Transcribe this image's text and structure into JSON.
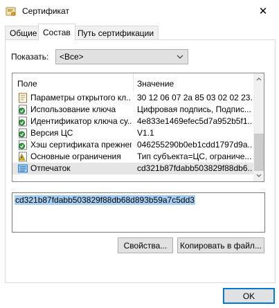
{
  "window": {
    "title": "Сертификат",
    "close_symbol": "✕"
  },
  "tabs": [
    {
      "label": "Общие"
    },
    {
      "label": "Состав",
      "active": true
    },
    {
      "label": "Путь сертификации"
    }
  ],
  "filter": {
    "label": "Показать:",
    "value": "<Все>"
  },
  "table": {
    "headers": {
      "field": "Поле",
      "value": "Значение"
    },
    "rows": [
      {
        "icon": "certificate-field-icon",
        "field": "Параметры открытого кл...",
        "value": "30 12 06 07 2a 85 03 02 02 23..."
      },
      {
        "icon": "extension-icon",
        "field": "Использование ключа",
        "value": "Цифровая подпись, Подпис..."
      },
      {
        "icon": "extension-icon",
        "field": "Идентификатор ключа су...",
        "value": "4e833e1469efec5d7a952b5f1..."
      },
      {
        "icon": "extension-icon",
        "field": "Версия ЦС",
        "value": "V1.1"
      },
      {
        "icon": "extension-icon",
        "field": "Хэш сертификата прежнег...",
        "value": "046255290b0eb1cdd1797d9a..."
      },
      {
        "icon": "critical-extension-icon",
        "field": "Основные ограничения",
        "value": "Тип субъекта=ЦС, ограниче..."
      },
      {
        "icon": "property-icon",
        "field": "Отпечаток",
        "value": "cd321b87fdabb503829f88db6...",
        "selected": true
      }
    ]
  },
  "detail": {
    "value": "cd321b87fdabb503829f88db68d893b59a7c5dd3"
  },
  "buttons": {
    "properties": "Свойства...",
    "copy_to_file": "Копировать в файл...",
    "ok": "OK"
  }
}
